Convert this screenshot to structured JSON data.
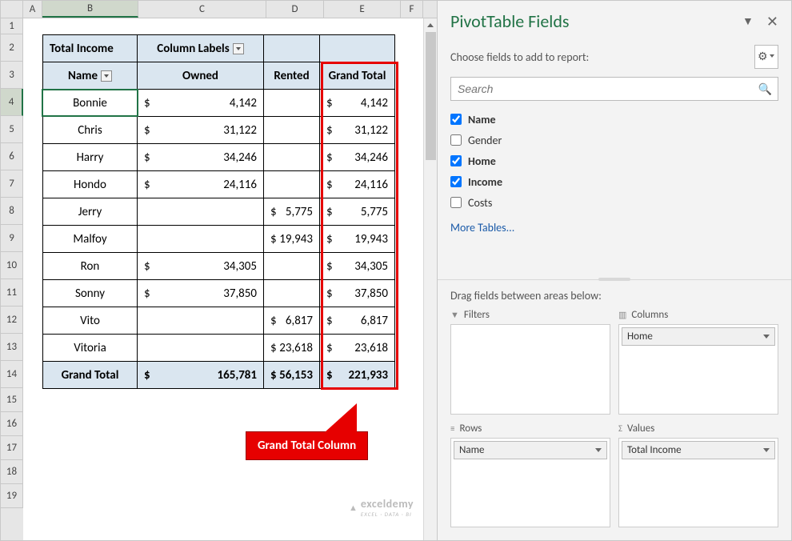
{
  "columns": {
    "A": "A",
    "B": "B",
    "C": "C",
    "D": "D",
    "E": "E",
    "F": "F"
  },
  "rows": [
    "1",
    "2",
    "3",
    "4",
    "5",
    "6",
    "7",
    "8",
    "9",
    "10",
    "11",
    "12",
    "13",
    "14",
    "15",
    "16",
    "17",
    "18",
    "19"
  ],
  "pivot": {
    "corner_label": "Total Income",
    "col_labels_header": "Column Labels",
    "row_header": "Name",
    "col_headers": [
      "Owned",
      "Rented",
      "Grand Total"
    ],
    "data": [
      {
        "name": "Bonnie",
        "owned": "4,142",
        "rented": "",
        "total": "4,142"
      },
      {
        "name": "Chris",
        "owned": "31,122",
        "rented": "",
        "total": "31,122"
      },
      {
        "name": "Harry",
        "owned": "34,246",
        "rented": "",
        "total": "34,246"
      },
      {
        "name": "Hondo",
        "owned": "24,116",
        "rented": "",
        "total": "24,116"
      },
      {
        "name": "Jerry",
        "owned": "",
        "rented": "5,775",
        "total": "5,775"
      },
      {
        "name": "Malfoy",
        "owned": "",
        "rented": "19,943",
        "total": "19,943"
      },
      {
        "name": "Ron",
        "owned": "34,305",
        "rented": "",
        "total": "34,305"
      },
      {
        "name": "Sonny",
        "owned": "37,850",
        "rented": "",
        "total": "37,850"
      },
      {
        "name": "Vito",
        "owned": "",
        "rented": "6,817",
        "total": "6,817"
      },
      {
        "name": "Vitoria",
        "owned": "",
        "rented": "23,618",
        "total": "23,618"
      }
    ],
    "grand_total_label": "Grand Total",
    "totals": {
      "owned": "165,781",
      "rented": "56,153",
      "total": "221,933"
    }
  },
  "callout": {
    "text": "Grand Total Column"
  },
  "pane": {
    "title": "PivotTable Fields",
    "subtitle": "Choose fields to add to report:",
    "search_placeholder": "Search",
    "fields": [
      {
        "label": "Name",
        "checked": true
      },
      {
        "label": "Gender",
        "checked": false
      },
      {
        "label": "Home",
        "checked": true
      },
      {
        "label": "Income",
        "checked": true
      },
      {
        "label": "Costs",
        "checked": false
      }
    ],
    "more_tables": "More Tables...",
    "drag_label": "Drag fields between areas below:",
    "areas": {
      "filters": {
        "title": "Filters",
        "items": []
      },
      "columns": {
        "title": "Columns",
        "items": [
          "Home"
        ]
      },
      "rows": {
        "title": "Rows",
        "items": [
          "Name"
        ]
      },
      "values": {
        "title": "Values",
        "items": [
          "Total Income"
        ]
      }
    }
  },
  "watermark": {
    "main": "exceldemy",
    "sub": "EXCEL · DATA · BI"
  }
}
